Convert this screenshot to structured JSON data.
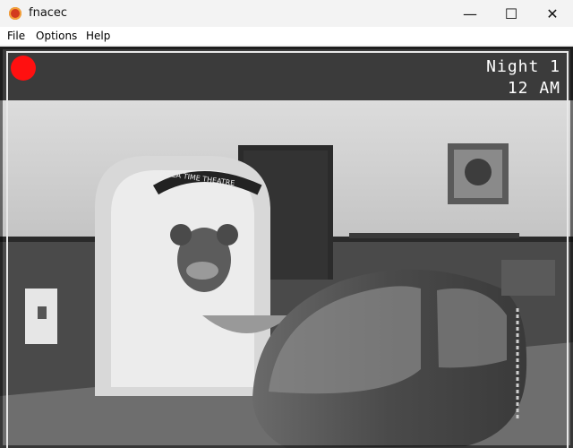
{
  "window": {
    "title": "fnacec",
    "minimize_glyph": "—",
    "maximize_glyph": "☐",
    "close_glyph": "✕"
  },
  "menu": {
    "items": [
      "File",
      "Options",
      "Help"
    ]
  },
  "camera": {
    "night_label": "Night 1",
    "time_label": "12 AM",
    "recording_color": "#ff1010",
    "sign_text": "PIZZA TIME THEATRE"
  }
}
